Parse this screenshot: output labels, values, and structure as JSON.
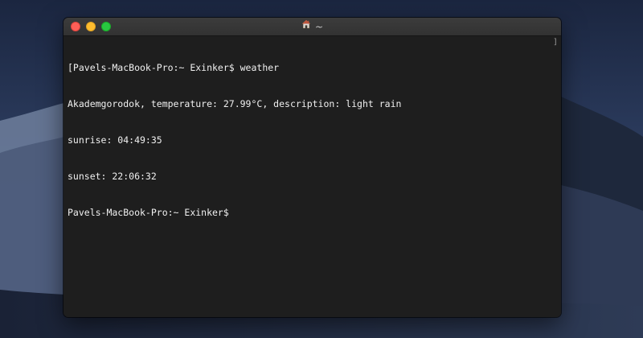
{
  "window": {
    "title": "~",
    "home_icon": "house-icon"
  },
  "terminal": {
    "lines": [
      "[Pavels-MacBook-Pro:~ Exinker$ weather",
      "Akademgorodok, temperature: 27.99°C, description: light rain",
      "sunrise: 04:49:35",
      "sunset: 22:06:32",
      "Pavels-MacBook-Pro:~ Exinker$ "
    ],
    "scroll_marker": "]"
  },
  "colors": {
    "close": "#fe5f57",
    "minimize": "#febc2e",
    "zoom": "#28c840",
    "terminal_bg": "#1e1e1e",
    "terminal_fg": "#f0f0f0"
  }
}
